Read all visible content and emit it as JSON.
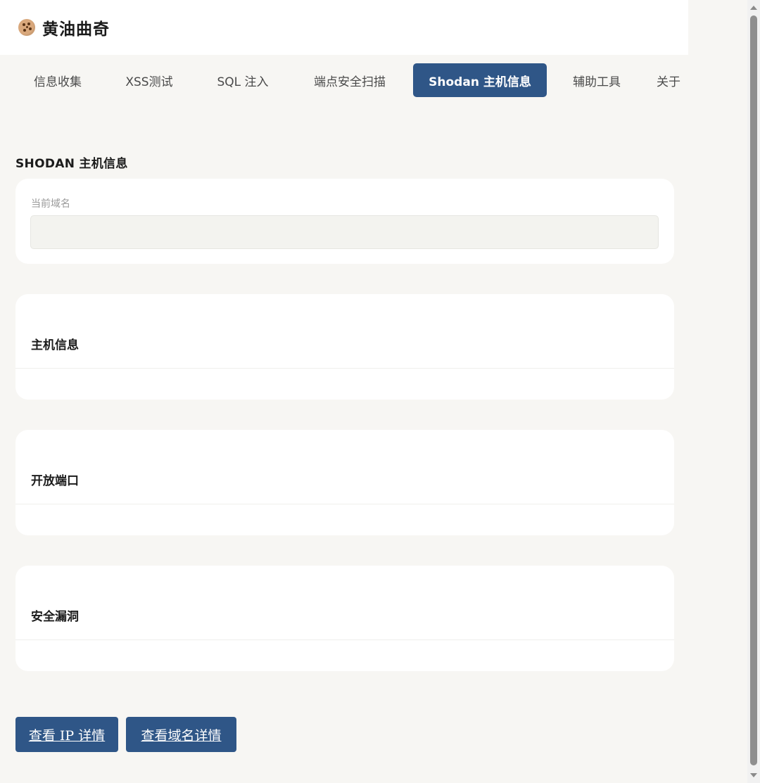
{
  "header": {
    "title": "黄油曲奇",
    "logo_icon": "cookie-icon"
  },
  "tabs": [
    {
      "label": "信息收集",
      "active": false
    },
    {
      "label": "XSS测试",
      "active": false
    },
    {
      "label": "SQL 注入",
      "active": false
    },
    {
      "label": "端点安全扫描",
      "active": false
    },
    {
      "label": "Shodan 主机信息",
      "active": true
    },
    {
      "label": "辅助工具",
      "active": false
    },
    {
      "label": "关于",
      "active": false
    }
  ],
  "section": {
    "title": "SHODAN 主机信息"
  },
  "domain_field": {
    "label": "当前域名",
    "value": ""
  },
  "cards": {
    "host_info": "主机信息",
    "open_ports": "开放端口",
    "vulnerabilities": "安全漏洞"
  },
  "buttons": {
    "view_ip": "查看 IP 详情",
    "view_domain": "查看域名详情"
  },
  "colors": {
    "accent": "#2f5687",
    "background": "#f7f6f3",
    "card": "#ffffff"
  }
}
